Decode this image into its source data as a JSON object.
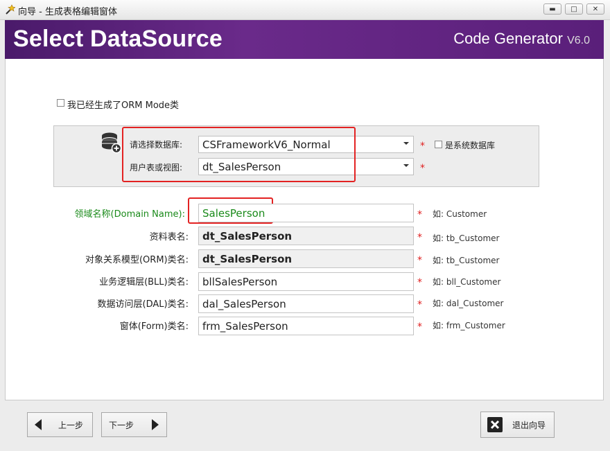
{
  "window": {
    "title": "向导 - 生成表格编辑窗体",
    "min_glyph": "▬",
    "max_glyph": "□",
    "close_glyph": "✕"
  },
  "banner": {
    "title": "Select DataSource",
    "product": "Code Generator ",
    "version": "V6.0",
    "bg_color": "#5a1f7a"
  },
  "orm_checkbox": {
    "label": "我已经生成了ORM Mode类",
    "checked": false
  },
  "datasource": {
    "db_label": "请选择数据库:",
    "db_value": "CSFrameworkV6_Normal",
    "system_db_label": "是系统数据库",
    "system_db_checked": false,
    "table_label": "用户表或视图:",
    "table_value": "dt_SalesPerson"
  },
  "fields": [
    {
      "label": "领域名称(Domain Name):",
      "value": "SalesPerson",
      "readonly": false,
      "hint": "如: Customer"
    },
    {
      "label": "资料表名:",
      "value": "dt_SalesPerson",
      "readonly": true,
      "hint": "如: tb_Customer"
    },
    {
      "label": "对象关系模型(ORM)类名:",
      "value": "dt_SalesPerson",
      "readonly": true,
      "hint": "如: tb_Customer"
    },
    {
      "label": "业务逻辑层(BLL)类名:",
      "value": "bllSalesPerson",
      "readonly": false,
      "hint": "如: bll_Customer"
    },
    {
      "label": "数据访问层(DAL)类名:",
      "value": "dal_SalesPerson",
      "readonly": false,
      "hint": "如: dal_Customer"
    },
    {
      "label": "窗体(Form)类名:",
      "value": "frm_SalesPerson",
      "readonly": false,
      "hint": "如: frm_Customer"
    }
  ],
  "required_mark": "*",
  "footer": {
    "prev_label": "上一步",
    "next_label": "下一步",
    "exit_label": "退出向导"
  },
  "colors": {
    "required": "#e02020",
    "highlight": "#e32222",
    "domain_text": "#1a8a1a"
  }
}
